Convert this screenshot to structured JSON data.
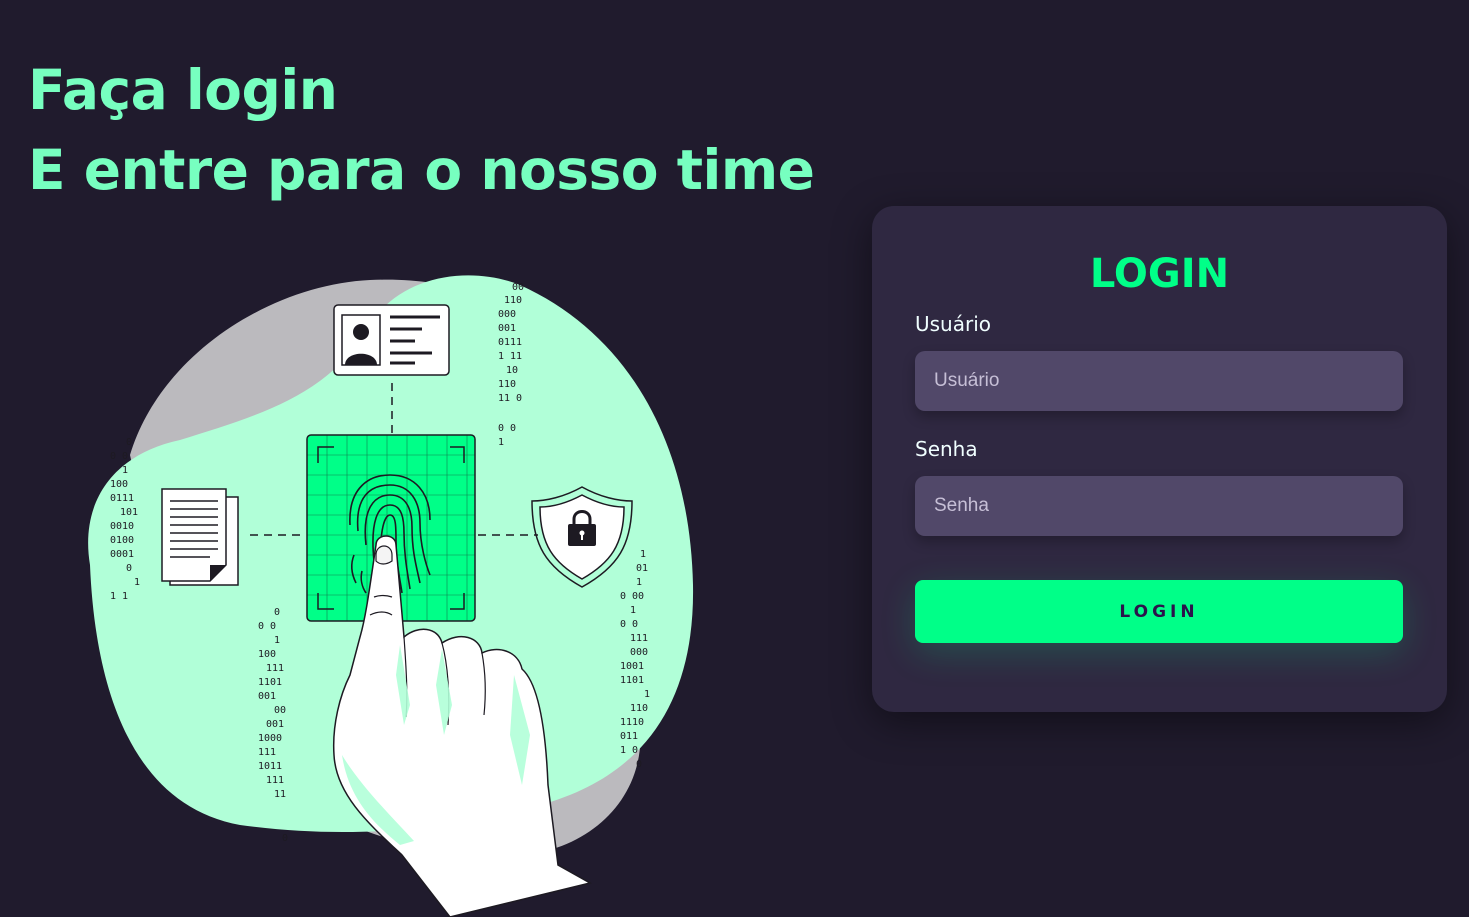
{
  "headline": {
    "line1": "Faça login",
    "line2": "E entre para o nosso time"
  },
  "illustration": {
    "icons": [
      "id-card-icon",
      "fingerprint-icon",
      "document-icon",
      "shield-lock-icon",
      "hand-icon"
    ],
    "colors": {
      "blob": "#b1ffd8",
      "blob_shadow": "#bbbabe",
      "scanner": "#00ff88",
      "outline": "#1d1a22"
    }
  },
  "login_card": {
    "title": "LOGIN",
    "username": {
      "label": "Usuário",
      "placeholder": "Usuário"
    },
    "password": {
      "label": "Senha",
      "placeholder": "Senha"
    },
    "submit_label": "LOGIN"
  },
  "colors": {
    "background": "#201b2d",
    "card": "#2f2841",
    "input": "#514869",
    "accent": "#00ff88",
    "headline": "#77ffc0"
  }
}
